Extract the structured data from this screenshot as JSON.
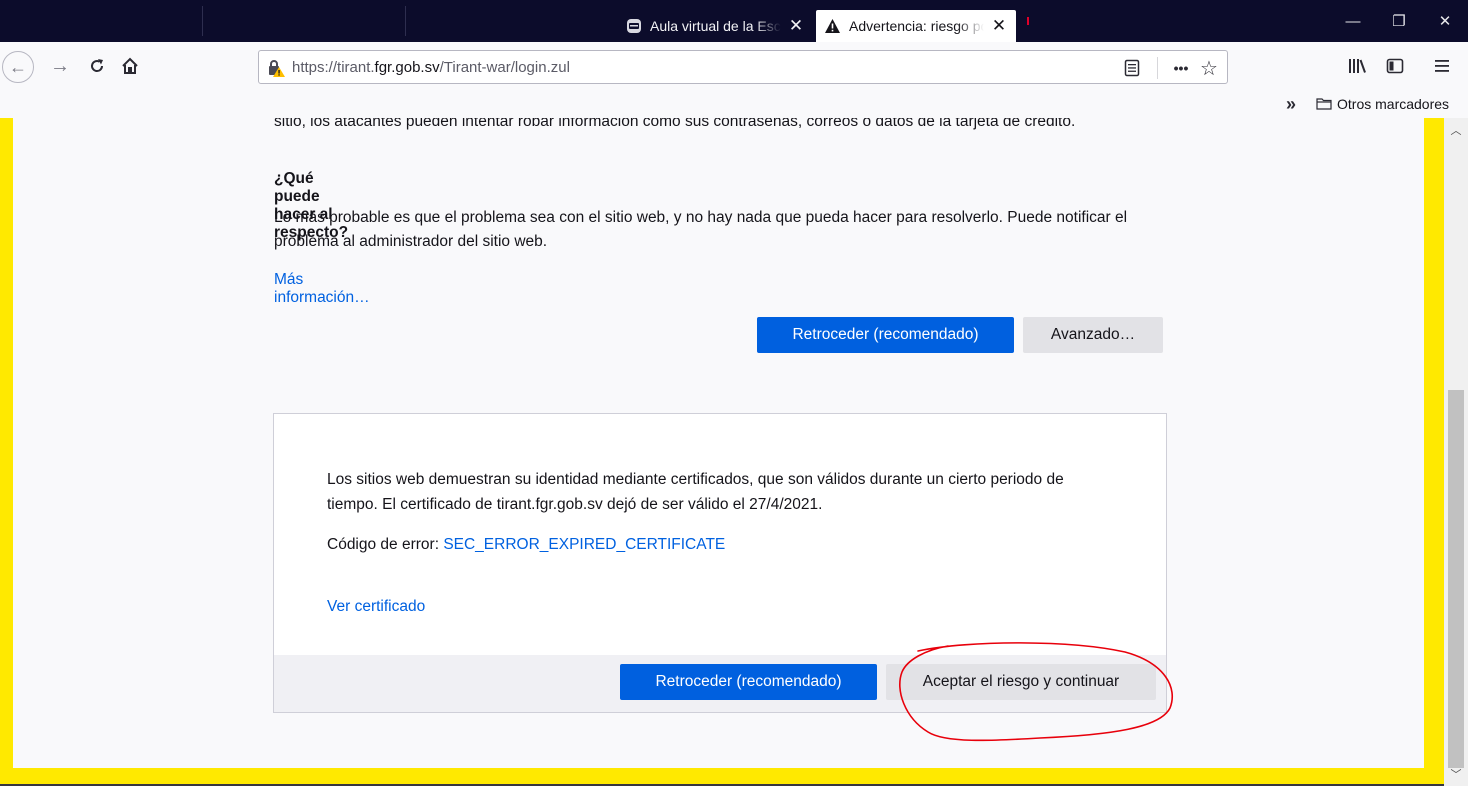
{
  "tabs": [
    {
      "label": "Aula virtual de la Escuela",
      "active": false
    },
    {
      "label": "Advertencia: riesgo potencial",
      "active": true
    }
  ],
  "window_controls": {
    "minimize": "—",
    "restore": "❐",
    "close": "✕"
  },
  "toolbar": {
    "url_prefix": "https://tirant.",
    "url_domain": "fgr.gob.sv",
    "url_path": "/Tirant-war/login.zul"
  },
  "bookmarks": {
    "overflow_label": "»",
    "folder_label": "Otros marcadores"
  },
  "page": {
    "cut_line": "sitio, los atacantes pueden intentar robar información como sus contraseñas, correos o datos de la tarjeta de crédito.",
    "heading": "¿Qué puede hacer al respecto?",
    "paragraph": "Lo más probable es que el problema sea con el sitio web, y no hay nada que pueda hacer para resolverlo. Puede notificar el problema al administrador del sitio web.",
    "more_info": "Más información…",
    "back_button": "Retroceder (recomendado)",
    "advanced_button": "Avanzado…"
  },
  "advanced": {
    "text": "Los sitios web demuestran su identidad mediante certificados, que son válidos durante un cierto periodo de tiempo. El certificado de tirant.fgr.gob.sv dejó de ser válido el 27/4/2021.",
    "error_label": "Código de error: ",
    "error_code": "SEC_ERROR_EXPIRED_CERTIFICATE",
    "view_cert": "Ver certificado",
    "back_button": "Retroceder (recomendado)",
    "accept_button": "Aceptar el riesgo y continuar"
  },
  "colors": {
    "accent": "#0060df",
    "link": "#0061e0",
    "highlight_frame": "#ffe900",
    "annotation": "#e8000b",
    "titlebar": "#0c0c2b"
  },
  "icons": [
    "back-icon",
    "forward-icon",
    "reload-icon",
    "home-icon",
    "insecure-lock-icon",
    "reader-view-icon",
    "page-actions-icon",
    "bookmark-star-icon",
    "library-icon",
    "sidebar-icon",
    "menu-icon",
    "folder-icon",
    "tab-favicon",
    "warning-icon"
  ]
}
